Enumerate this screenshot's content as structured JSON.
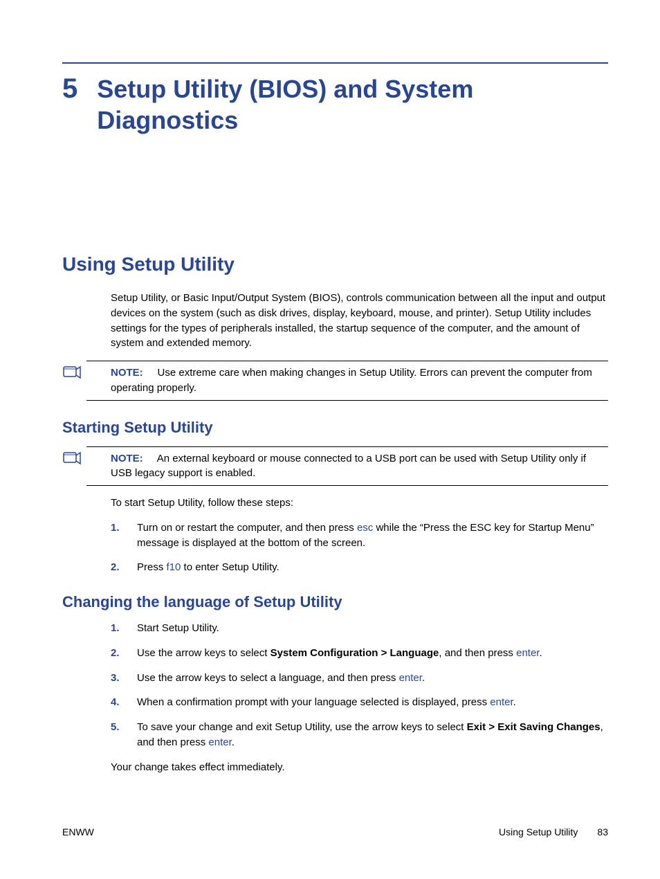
{
  "chapter": {
    "number": "5",
    "title": "Setup Utility (BIOS) and System Diagnostics"
  },
  "section1": {
    "heading": "Using Setup Utility",
    "intro": "Setup Utility, or Basic Input/Output System (BIOS), controls communication between all the input and output devices on the system (such as disk drives, display, keyboard, mouse, and printer). Setup Utility includes settings for the types of peripherals installed, the startup sequence of the computer, and the amount of system and extended memory.",
    "note": {
      "label": "NOTE:",
      "text": "Use extreme care when making changes in Setup Utility. Errors can prevent the computer from operating properly."
    }
  },
  "starting": {
    "heading": "Starting Setup Utility",
    "note": {
      "label": "NOTE:",
      "text": "An external keyboard or mouse connected to a USB port can be used with Setup Utility only if USB legacy support is enabled."
    },
    "lead": "To start Setup Utility, follow these steps:",
    "step1_a": "Turn on or restart the computer, and then press ",
    "step1_key": "esc",
    "step1_b": " while the “Press the ESC key for Startup Menu” message is displayed at the bottom of the screen.",
    "step2_a": "Press ",
    "step2_key": "f10",
    "step2_b": " to enter Setup Utility."
  },
  "changing": {
    "heading": "Changing the language of Setup Utility",
    "step1": "Start Setup Utility.",
    "step2_a": "Use the arrow keys to select ",
    "step2_bold": "System Configuration > Language",
    "step2_b": ", and then press ",
    "step2_key": "enter",
    "step2_c": ".",
    "step3_a": "Use the arrow keys to select a language, and then press ",
    "step3_key": "enter",
    "step3_b": ".",
    "step4_a": "When a confirmation prompt with your language selected is displayed, press ",
    "step4_key": "enter",
    "step4_b": ".",
    "step5_a": "To save your change and exit Setup Utility, use the arrow keys to select ",
    "step5_bold": "Exit > Exit Saving Changes",
    "step5_b": ", and then press ",
    "step5_key": "enter",
    "step5_c": ".",
    "outro": "Your change takes effect immediately."
  },
  "footer": {
    "left": "ENWW",
    "right_label": "Using Setup Utility",
    "page": "83"
  }
}
